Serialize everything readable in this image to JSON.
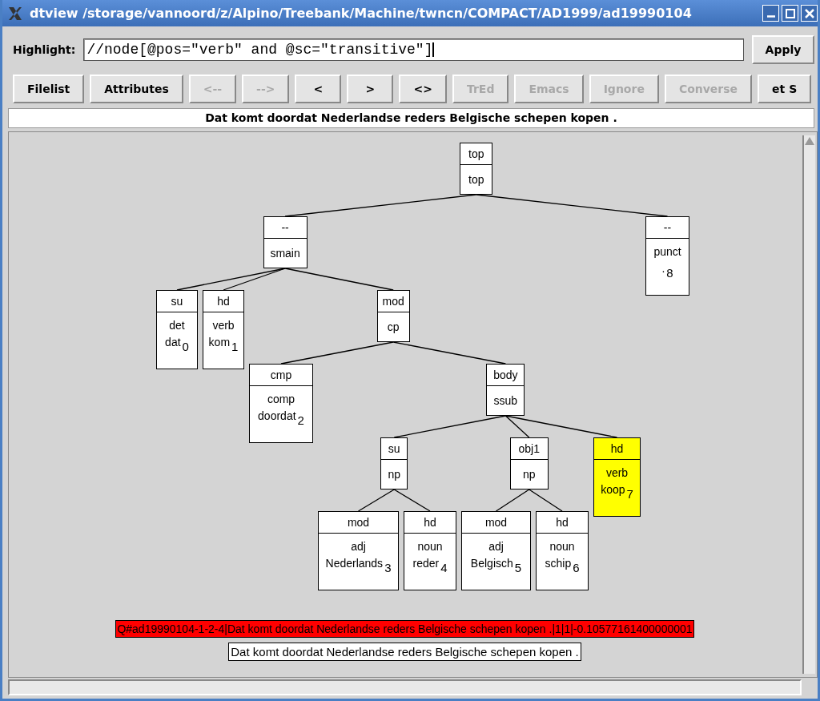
{
  "window": {
    "title": "dtview /storage/vannoord/z/Alpino/Treebank/Machine/twncn/COMPACT/AD1999/ad19990104"
  },
  "highlight": {
    "label": "Highlight:",
    "value": "//node[@pos=\"verb\" and @sc=\"transitive\"]",
    "apply": "Apply"
  },
  "toolbar": [
    {
      "label": "Filelist",
      "disabled": false
    },
    {
      "label": "Attributes",
      "disabled": false
    },
    {
      "label": "<--",
      "disabled": true
    },
    {
      "label": "-->",
      "disabled": true
    },
    {
      "label": "<",
      "disabled": false
    },
    {
      "label": ">",
      "disabled": false
    },
    {
      "label": "<>",
      "disabled": false
    },
    {
      "label": "TrEd",
      "disabled": true
    },
    {
      "label": "Emacs",
      "disabled": true
    },
    {
      "label": "Ignore",
      "disabled": true
    },
    {
      "label": "Converse",
      "disabled": true
    },
    {
      "label": "et S",
      "disabled": false
    }
  ],
  "sentence": "Dat komt doordat Nederlandse reders Belgische schepen kopen .",
  "tree": {
    "rel": "top",
    "cat": "top",
    "highlighted": false,
    "children": [
      {
        "rel": "--",
        "cat": "smain",
        "highlighted": false,
        "children": [
          {
            "rel": "su",
            "pos": "det",
            "word": "dat",
            "index": "0",
            "highlighted": false
          },
          {
            "rel": "hd",
            "pos": "verb",
            "word": "kom",
            "index": "1",
            "highlighted": false
          },
          {
            "rel": "mod",
            "cat": "cp",
            "highlighted": false,
            "children": [
              {
                "rel": "cmp",
                "pos": "comp",
                "word": "doordat",
                "index": "2",
                "highlighted": false
              },
              {
                "rel": "body",
                "cat": "ssub",
                "highlighted": false,
                "children": [
                  {
                    "rel": "su",
                    "cat": "np",
                    "highlighted": false,
                    "children": [
                      {
                        "rel": "mod",
                        "pos": "adj",
                        "word": "Nederlands",
                        "index": "3",
                        "highlighted": false
                      },
                      {
                        "rel": "hd",
                        "pos": "noun",
                        "word": "reder",
                        "index": "4",
                        "highlighted": false
                      }
                    ]
                  },
                  {
                    "rel": "obj1",
                    "cat": "np",
                    "highlighted": false,
                    "children": [
                      {
                        "rel": "mod",
                        "pos": "adj",
                        "word": "Belgisch",
                        "index": "5",
                        "highlighted": false
                      },
                      {
                        "rel": "hd",
                        "pos": "noun",
                        "word": "schip",
                        "index": "6",
                        "highlighted": false
                      }
                    ]
                  },
                  {
                    "rel": "hd",
                    "pos": "verb",
                    "word": "koop",
                    "index": "7",
                    "highlighted": true
                  }
                ]
              }
            ]
          }
        ]
      },
      {
        "rel": "--",
        "pos": "punct",
        "word": ".",
        "index": "8",
        "highlighted": false
      }
    ]
  },
  "status": "Q#ad19990104-1-2-4|Dat komt doordat Nederlandse reders Belgische schepen kopen .|1|1|-0.10577161400000001",
  "sentence_box": "Dat komt doordat Nederlandse reders Belgische schepen kopen ."
}
